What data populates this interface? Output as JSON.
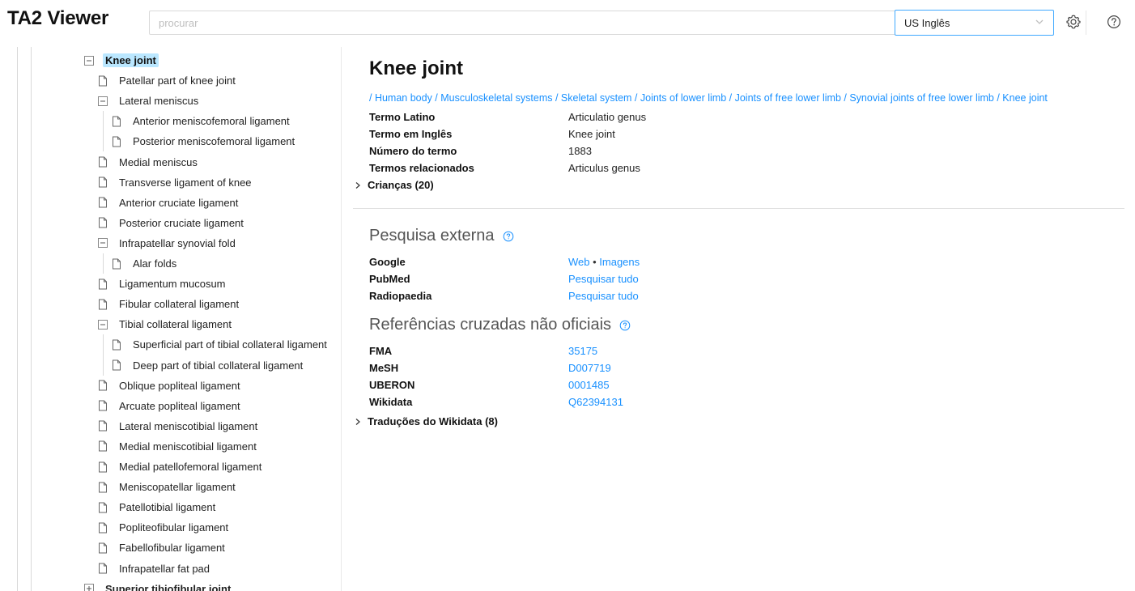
{
  "header": {
    "app_title": "TA2 Viewer",
    "search_placeholder": "procurar",
    "language_value": "US Inglês"
  },
  "tree": [
    {
      "label": "Knee joint",
      "icon": "minus-square-icon",
      "level": 0,
      "selected": true
    },
    {
      "label": "Patellar part of knee joint",
      "icon": "file-icon",
      "level": 1
    },
    {
      "label": "Lateral meniscus",
      "icon": "minus-square-icon",
      "level": 1
    },
    {
      "label": "Anterior meniscofemoral ligament",
      "icon": "file-icon",
      "level": 2
    },
    {
      "label": "Posterior meniscofemoral ligament",
      "icon": "file-icon",
      "level": 2
    },
    {
      "label": "Medial meniscus",
      "icon": "file-icon",
      "level": 1
    },
    {
      "label": "Transverse ligament of knee",
      "icon": "file-icon",
      "level": 1
    },
    {
      "label": "Anterior cruciate ligament",
      "icon": "file-icon",
      "level": 1
    },
    {
      "label": "Posterior cruciate ligament",
      "icon": "file-icon",
      "level": 1
    },
    {
      "label": "Infrapatellar synovial fold",
      "icon": "minus-square-icon",
      "level": 1
    },
    {
      "label": "Alar folds",
      "icon": "file-icon",
      "level": 2
    },
    {
      "label": "Ligamentum mucosum",
      "icon": "file-icon",
      "level": 1
    },
    {
      "label": "Fibular collateral ligament",
      "icon": "file-icon",
      "level": 1
    },
    {
      "label": "Tibial collateral ligament",
      "icon": "minus-square-icon",
      "level": 1
    },
    {
      "label": "Superficial part of tibial collateral ligament",
      "icon": "file-icon",
      "level": 2
    },
    {
      "label": "Deep part of tibial collateral ligament",
      "icon": "file-icon",
      "level": 2
    },
    {
      "label": "Oblique popliteal ligament",
      "icon": "file-icon",
      "level": 1
    },
    {
      "label": "Arcuate popliteal ligament",
      "icon": "file-icon",
      "level": 1
    },
    {
      "label": "Lateral meniscotibial ligament",
      "icon": "file-icon",
      "level": 1
    },
    {
      "label": "Medial meniscotibial ligament",
      "icon": "file-icon",
      "level": 1
    },
    {
      "label": "Medial patellofemoral ligament",
      "icon": "file-icon",
      "level": 1
    },
    {
      "label": "Meniscopatellar ligament",
      "icon": "file-icon",
      "level": 1
    },
    {
      "label": "Patellotibial ligament",
      "icon": "file-icon",
      "level": 1
    },
    {
      "label": "Popliteofibular ligament",
      "icon": "file-icon",
      "level": 1
    },
    {
      "label": "Fabellofibular ligament",
      "icon": "file-icon",
      "level": 1
    },
    {
      "label": "Infrapatellar fat pad",
      "icon": "file-icon",
      "level": 1
    },
    {
      "label": "Superior tibiofibular joint",
      "icon": "plus-square-icon",
      "level": 0,
      "bold": true
    }
  ],
  "content": {
    "title": "Knee joint",
    "breadcrumb": [
      "Human body",
      "Musculoskeletal systems",
      "Skeletal system",
      "Joints of lower limb",
      "Joints of free lower limb",
      "Synovial joints of free lower limb",
      "Knee joint"
    ],
    "fields": [
      {
        "key": "Termo Latino",
        "value": "Articulatio genus"
      },
      {
        "key": "Termo em Inglês",
        "value": "Knee joint"
      },
      {
        "key": "Número do termo",
        "value": "1883"
      },
      {
        "key": "Termos relacionados",
        "value": "Articulus genus"
      }
    ],
    "children_label": "Crianças (20)",
    "external_title": "Pesquisa externa",
    "external": [
      {
        "key": "Google",
        "links": [
          "Web",
          "Imagens"
        ]
      },
      {
        "key": "PubMed",
        "links": [
          "Pesquisar tudo"
        ]
      },
      {
        "key": "Radiopaedia",
        "links": [
          "Pesquisar tudo"
        ]
      }
    ],
    "xref_title": "Referências cruzadas não oficiais",
    "xrefs": [
      {
        "key": "FMA",
        "value": "35175"
      },
      {
        "key": "MeSH",
        "value": "D007719"
      },
      {
        "key": "UBERON",
        "value": "0001485"
      },
      {
        "key": "Wikidata",
        "value": "Q62394131"
      }
    ],
    "wikidata_translations_label": "Traduções do Wikidata (8)"
  },
  "colors": {
    "link": "#1890ff",
    "selected_bg": "#bae7ff",
    "focus_border": "#40a9ff"
  }
}
